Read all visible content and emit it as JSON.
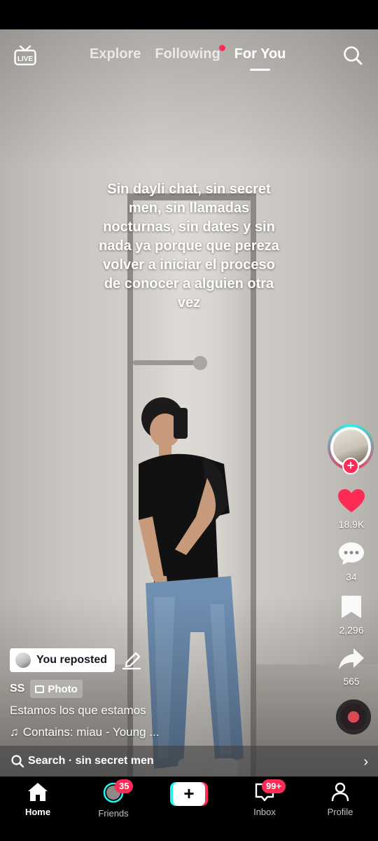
{
  "top_nav": {
    "live_label": "LIVE",
    "tabs": [
      {
        "label": "Explore"
      },
      {
        "label": "Following"
      },
      {
        "label": "For You"
      }
    ]
  },
  "post": {
    "overlay_text": "Sin dayli chat, sin secret men, sin llamadas nocturnas, sin dates y sin nada ya porque que pereza volver a iniciar el proceso de conocer a alguien otra vez",
    "repost_label": "You reposted",
    "author": "SS",
    "type_badge": "Photo",
    "caption": "Estamos los que estamos",
    "music": "Contains: miau - Young ...",
    "search_prefix": "Search",
    "search_query": "sin secret men"
  },
  "actions": {
    "likes": "18.9K",
    "comments": "34",
    "saves": "2,296",
    "shares": "565"
  },
  "bottom_nav": {
    "home": "Home",
    "friends": "Friends",
    "friends_badge": "35",
    "inbox": "Inbox",
    "inbox_badge": "99+",
    "profile": "Profile"
  },
  "colors": {
    "accent_red": "#fe2c55",
    "accent_cyan": "#25f4ee"
  }
}
